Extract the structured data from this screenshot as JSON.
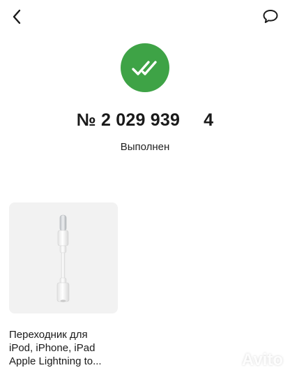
{
  "header": {
    "back_icon": "chevron-left-icon",
    "chat_icon": "chat-bubble-icon"
  },
  "order": {
    "status_icon": "double-check-icon",
    "status_color": "#3ea346",
    "number": "№ 2 029 939",
    "suffix": "4",
    "status": "Выполнен"
  },
  "product": {
    "title_lines": [
      "Переходник для",
      "iPod, iPhone, iPad",
      "Apple Lightning to..."
    ]
  },
  "watermark": {
    "text": "Avito"
  }
}
